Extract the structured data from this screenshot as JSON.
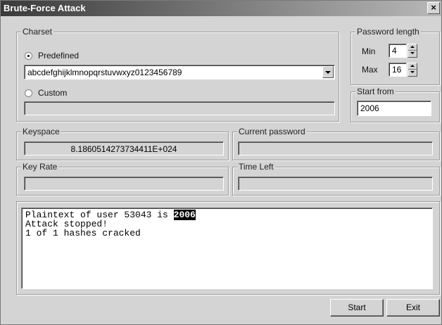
{
  "window": {
    "title": "Brute-Force Attack",
    "close_glyph": "×"
  },
  "charset": {
    "legend": "Charset",
    "predefined_label": "Predefined",
    "predefined_selected": true,
    "predefined_value": "abcdefghijklmnopqrstuvwxyz0123456789",
    "custom_label": "Custom",
    "custom_value": ""
  },
  "password_length": {
    "legend": "Password length",
    "min_label": "Min",
    "min_value": "4",
    "max_label": "Max",
    "max_value": "16"
  },
  "start_from": {
    "legend": "Start from",
    "value": "2006"
  },
  "keyspace": {
    "legend": "Keyspace",
    "value": "8.1860514273734411E+024"
  },
  "current_password": {
    "legend": "Current password",
    "value": ""
  },
  "key_rate": {
    "legend": "Key Rate",
    "value": ""
  },
  "time_left": {
    "legend": "Time Left",
    "value": ""
  },
  "output": {
    "line1_prefix": "Plaintext of user 53043 is ",
    "line1_highlight": "2006",
    "line2": "Attack stopped!",
    "line3": "1 of 1 hashes cracked"
  },
  "buttons": {
    "start": "Start",
    "exit": "Exit"
  }
}
